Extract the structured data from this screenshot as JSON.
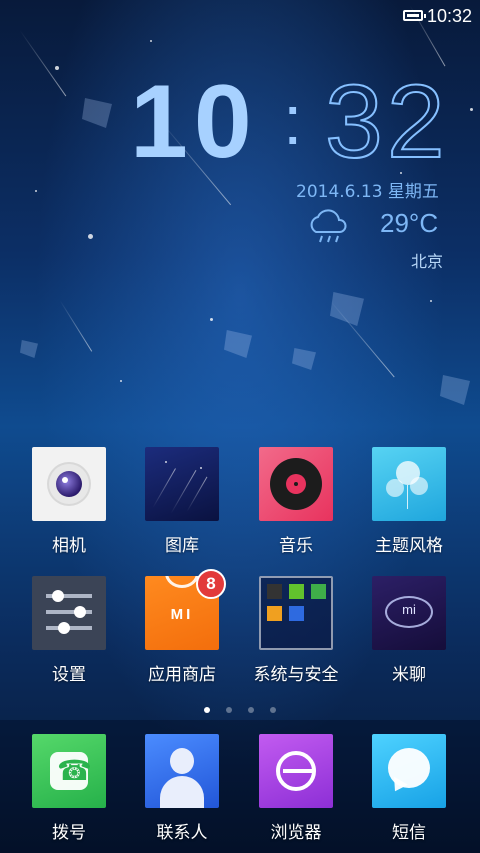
{
  "status_bar": {
    "time": "10:32",
    "battery_icon": "battery-full-icon"
  },
  "lockclock": {
    "hour": "10",
    "minute": "32",
    "date": "2014.6.13  星期五",
    "weather_icon": "cloud-rain-icon",
    "temperature": "29°C",
    "city": "北京"
  },
  "apps_row1": [
    {
      "label": "相机",
      "icon": "camera-icon"
    },
    {
      "label": "图库",
      "icon": "gallery-icon"
    },
    {
      "label": "音乐",
      "icon": "music-record-icon"
    },
    {
      "label": "主题风格",
      "icon": "themes-balloon-icon"
    }
  ],
  "apps_row2": [
    {
      "label": "设置",
      "icon": "settings-sliders-icon"
    },
    {
      "label": "应用商店",
      "icon": "mi-store-icon",
      "badge": "8"
    },
    {
      "label": "系统与安全",
      "icon": "folder-icon"
    },
    {
      "label": "米聊",
      "icon": "miliao-chat-icon"
    }
  ],
  "page_indicator": {
    "count": 4,
    "active": 0
  },
  "dock": [
    {
      "label": "拨号",
      "icon": "phone-icon"
    },
    {
      "label": "联系人",
      "icon": "contacts-icon"
    },
    {
      "label": "浏览器",
      "icon": "browser-icon"
    },
    {
      "label": "短信",
      "icon": "messages-icon"
    }
  ],
  "colors": {
    "clock": "#a7d1ff",
    "badge": "#e23a3a"
  }
}
